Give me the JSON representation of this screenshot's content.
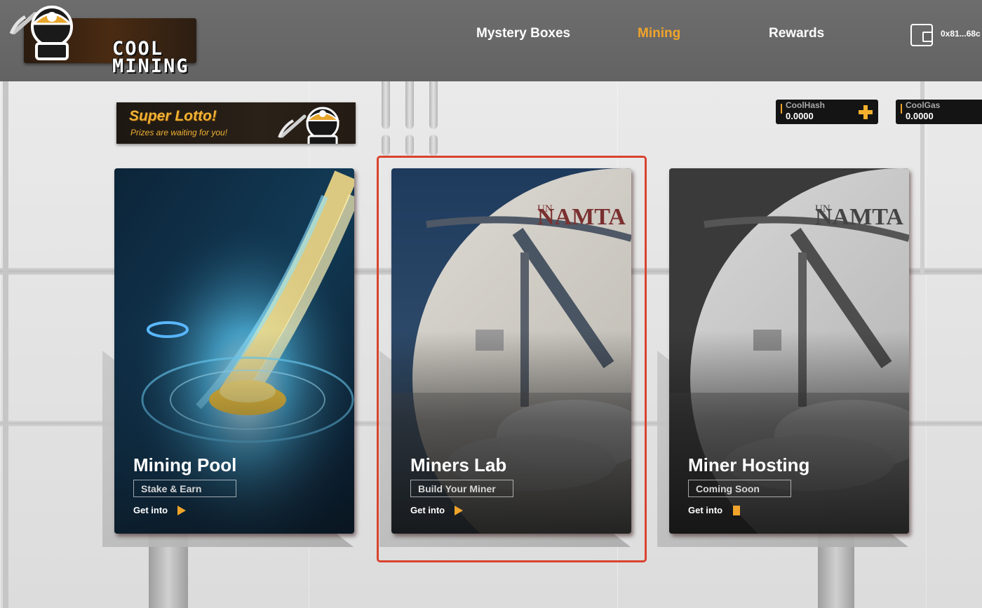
{
  "header": {
    "logo_text_line1": "COOL",
    "logo_text_line2": "MINING",
    "nav": [
      {
        "label": "Mystery Boxes",
        "active": false
      },
      {
        "label": "Mining",
        "active": true
      },
      {
        "label": "Rewards",
        "active": false
      }
    ],
    "wallet": {
      "icon": "wallet-icon",
      "address": "0x81...68c"
    }
  },
  "banner": {
    "title": "Super Lotto!",
    "subtitle": "Prizes are waiting for you!"
  },
  "balances": [
    {
      "label": "CoolHash",
      "value": "0.0000",
      "icon": "plus-icon"
    },
    {
      "label": "CoolGas",
      "value": "0.0000"
    }
  ],
  "cards": [
    {
      "title": "Mining Pool",
      "tag": "Stake & Earn",
      "cta": "Get into",
      "cta_icon": "play-icon"
    },
    {
      "title": "Miners Lab",
      "tag": "Build Your Miner",
      "cta": "Get into",
      "cta_icon": "play-icon"
    },
    {
      "title": "Miner Hosting",
      "tag": "Coming Soon",
      "cta": "Get into",
      "cta_icon": "stop-icon"
    }
  ],
  "art": {
    "station_text_small": "UN",
    "station_text_large": "NAMTA"
  },
  "colors": {
    "accent": "#f0a42a",
    "highlight": "#d9432f",
    "topbar": "#666666"
  }
}
